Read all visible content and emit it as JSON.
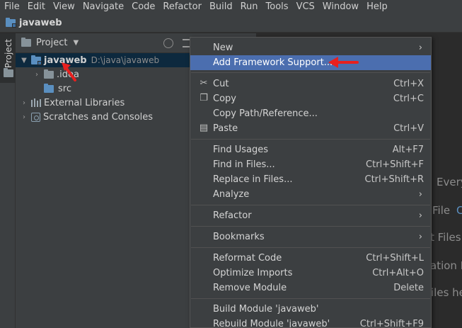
{
  "menubar": {
    "items": [
      "File",
      "Edit",
      "View",
      "Navigate",
      "Code",
      "Refactor",
      "Build",
      "Run",
      "Tools",
      "VCS",
      "Window",
      "Help"
    ]
  },
  "navbar": {
    "title": "javaweb"
  },
  "toolstrip": {
    "project_tab": "Project"
  },
  "panel": {
    "title": "Project",
    "tree": [
      {
        "label": "javaweb",
        "path": "D:\\java\\javaweb"
      },
      {
        "label": ".idea"
      },
      {
        "label": "src"
      },
      {
        "label": "External Libraries"
      },
      {
        "label": "Scratches and Consoles"
      }
    ]
  },
  "editor_hints": [
    "Every",
    "File",
    "C",
    "t Files",
    "ation E",
    "iles he"
  ],
  "context_menu": {
    "items": [
      {
        "label": "New",
        "shortcut": "",
        "submenu": true
      },
      {
        "label": "Add Framework Support...",
        "shortcut": "",
        "submenu": false
      },
      {
        "label": "Cut",
        "shortcut": "Ctrl+X",
        "icon": "scissors-icon"
      },
      {
        "label": "Copy",
        "shortcut": "Ctrl+C",
        "icon": "copy-icon"
      },
      {
        "label": "Copy Path/Reference...",
        "shortcut": ""
      },
      {
        "label": "Paste",
        "shortcut": "Ctrl+V",
        "icon": "paste-icon"
      },
      {
        "label": "Find Usages",
        "shortcut": "Alt+F7"
      },
      {
        "label": "Find in Files...",
        "shortcut": "Ctrl+Shift+F"
      },
      {
        "label": "Replace in Files...",
        "shortcut": "Ctrl+Shift+R"
      },
      {
        "label": "Analyze",
        "shortcut": "",
        "submenu": true
      },
      {
        "label": "Refactor",
        "shortcut": "",
        "submenu": true
      },
      {
        "label": "Bookmarks",
        "shortcut": "",
        "submenu": true
      },
      {
        "label": "Reformat Code",
        "shortcut": "Ctrl+Shift+L"
      },
      {
        "label": "Optimize Imports",
        "shortcut": "Ctrl+Alt+O"
      },
      {
        "label": "Remove Module",
        "shortcut": "Delete"
      },
      {
        "label": "Build Module 'javaweb'",
        "shortcut": ""
      },
      {
        "label": "Rebuild Module 'javaweb'",
        "shortcut": "Ctrl+Shift+F9"
      }
    ],
    "submenu_glyph": "›"
  },
  "colors": {
    "highlight": "#4b6eaf",
    "annotation": "#e8201e",
    "selection": "#0d293e"
  }
}
